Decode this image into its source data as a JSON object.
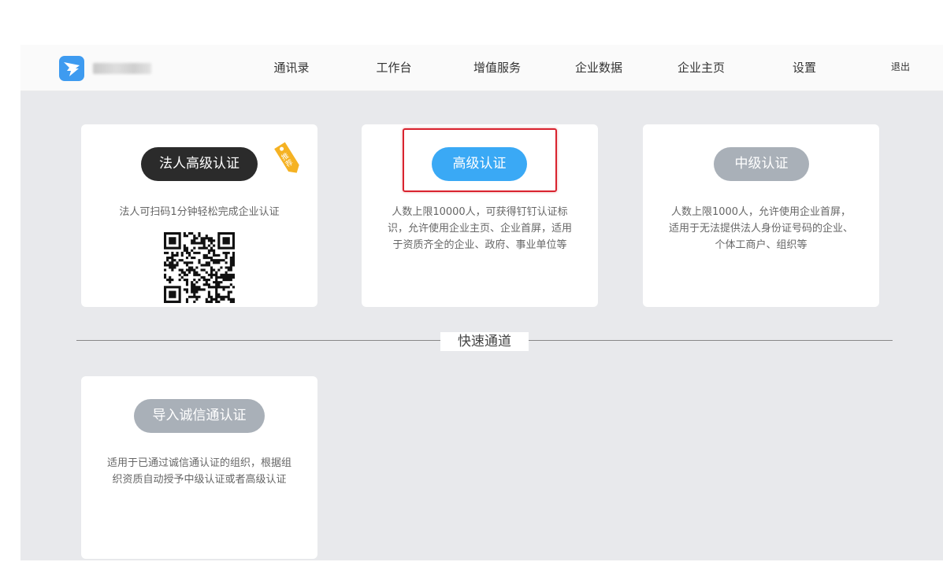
{
  "header": {
    "nav": [
      "通讯录",
      "工作台",
      "增值服务",
      "企业数据",
      "企业主页",
      "设置"
    ],
    "logout": "退出"
  },
  "cards": {
    "legal": {
      "button": "法人高级认证",
      "tag": "推荐",
      "desc": "法人可扫码1分钟轻松完成企业认证"
    },
    "advanced": {
      "button": "高级认证",
      "desc": "人数上限10000人，可获得钉钉认证标识，允许使用企业主页、企业首屏，适用于资质齐全的企业、政府、事业单位等"
    },
    "intermediate": {
      "button": "中级认证",
      "desc": "人数上限1000人，允许使用企业首屏，适用于无法提供法人身份证号码的企业、个体工商户、组织等"
    },
    "import": {
      "button": "导入诚信通认证",
      "desc": "适用于已通过诚信通认证的组织，根据组织资质自动授予中级认证或者高级认证"
    }
  },
  "divider": {
    "label": "快速通道"
  },
  "colors": {
    "primary_blue": "#3aa9f5",
    "dark_button": "#2b2b2b",
    "gray_button": "#a9b0b8",
    "tag_orange": "#f5b223",
    "highlight_red": "#d9232f",
    "background": "#e8e9ec"
  },
  "icons": {
    "logo": "dingtalk-logo-icon",
    "tag": "recommend-tag-icon",
    "qr": "qr-code-icon"
  }
}
